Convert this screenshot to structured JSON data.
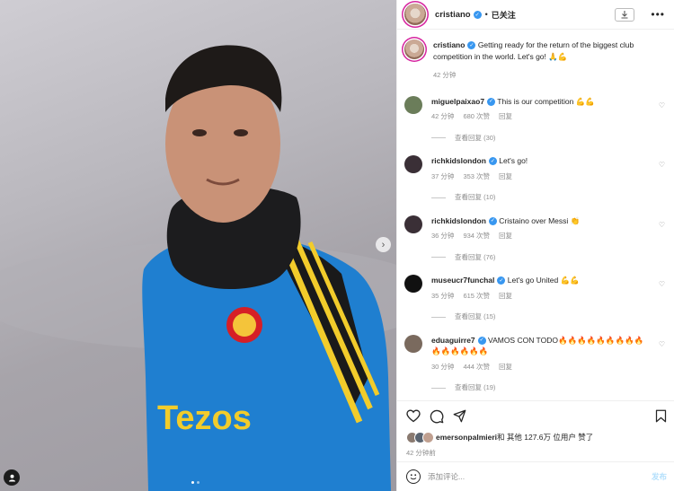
{
  "post": {
    "username": "cristiano",
    "follow_status": "已关注",
    "caption": "Getting ready for the return of the biggest club competition in the world. Let's go! 🙏💪",
    "caption_time": "42 分钟",
    "photo": {
      "alt": "Cristiano Ronaldo in training kit",
      "shirt_text": "Tezos",
      "slide_count": 2,
      "active_slide": 0
    }
  },
  "comments": [
    {
      "user": "miguelpaixao7",
      "text": "This is our competition 💪💪",
      "time": "42 分钟",
      "likes": "680 次赞",
      "reply": "回复",
      "view_replies": "查看回复 (30)",
      "avatar_color": "#6b7d5a"
    },
    {
      "user": "richkidslondon",
      "text": "Let's go!",
      "time": "37 分钟",
      "likes": "353 次赞",
      "reply": "回复",
      "view_replies": "查看回复 (10)",
      "avatar_color": "#3a2f36"
    },
    {
      "user": "richkidslondon",
      "text": "Cristaino over Messi 👏",
      "time": "36 分钟",
      "likes": "934 次赞",
      "reply": "回复",
      "view_replies": "查看回复 (76)",
      "avatar_color": "#3a2f36"
    },
    {
      "user": "museucr7funchal",
      "text": "Let's go United 💪💪",
      "time": "35 分钟",
      "likes": "615 次赞",
      "reply": "回复",
      "view_replies": "查看回复 (15)",
      "avatar_color": "#111111"
    },
    {
      "user": "eduaguirre7",
      "text": "VAMOS CON TODO🔥🔥🔥🔥🔥🔥🔥🔥🔥🔥🔥🔥🔥🔥🔥",
      "time": "30 分钟",
      "likes": "444 次赞",
      "reply": "回复",
      "view_replies": "查看回复 (19)",
      "avatar_color": "#7a6a5e"
    }
  ],
  "likes": {
    "first_user": "emersonpalmieri",
    "rest": " 和 其他 127.6万 位用户 赞了"
  },
  "post_time": "42 分钟前",
  "add_comment": {
    "placeholder": "添加评论...",
    "post_label": "发布"
  },
  "colors": {
    "verified": "#3897f0",
    "post_button": "#b2dffc",
    "story_ring": "#d6249f"
  }
}
